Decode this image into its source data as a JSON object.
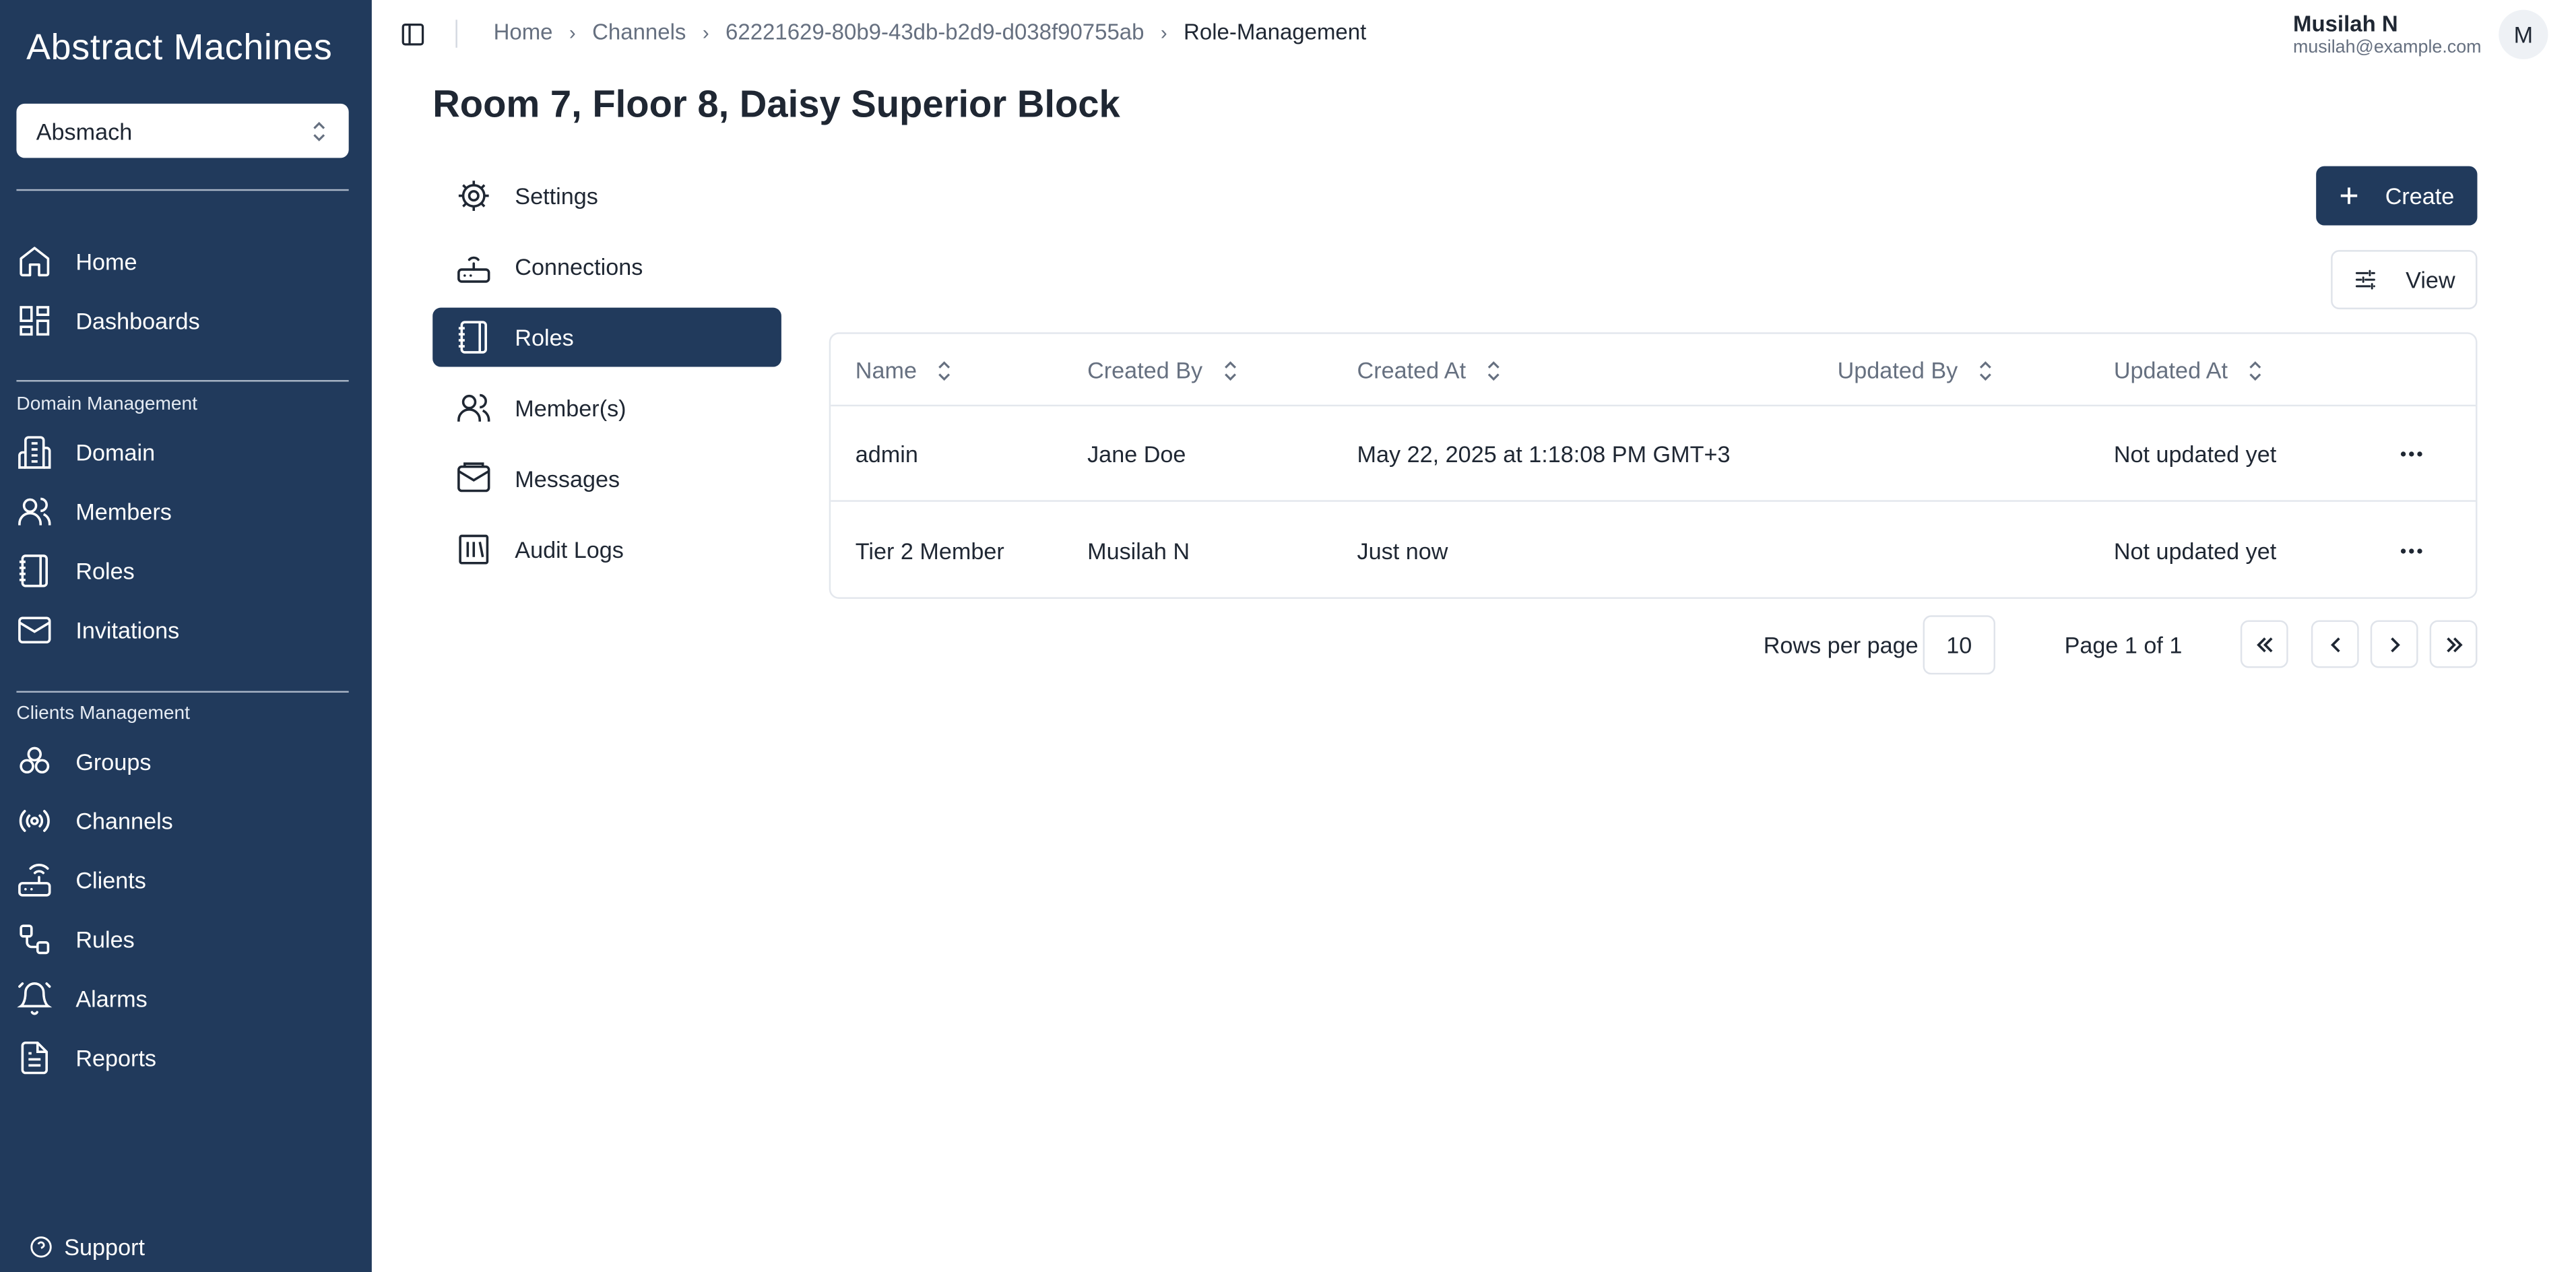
{
  "app": {
    "brand": "Abstract Machines"
  },
  "sidebar": {
    "domain_selector": "Absmach",
    "top_items": [
      {
        "label": "Home",
        "icon": "home-icon"
      },
      {
        "label": "Dashboards",
        "icon": "dashboard-icon"
      }
    ],
    "domain_section": {
      "title": "Domain Management",
      "items": [
        {
          "label": "Domain",
          "icon": "building-icon"
        },
        {
          "label": "Members",
          "icon": "users-icon"
        },
        {
          "label": "Roles",
          "icon": "notebook-icon"
        },
        {
          "label": "Invitations",
          "icon": "mail-icon"
        }
      ]
    },
    "clients_section": {
      "title": "Clients Management",
      "items": [
        {
          "label": "Groups",
          "icon": "groups-icon"
        },
        {
          "label": "Channels",
          "icon": "radio-icon"
        },
        {
          "label": "Clients",
          "icon": "router-icon"
        },
        {
          "label": "Rules",
          "icon": "workflow-icon"
        },
        {
          "label": "Alarms",
          "icon": "bell-icon"
        },
        {
          "label": "Reports",
          "icon": "file-icon"
        }
      ]
    },
    "support_label": "Support"
  },
  "breadcrumb": [
    "Home",
    "Channels",
    "62221629-80b9-43db-b2d9-d038f90755ab",
    "Role-Management"
  ],
  "user": {
    "name": "Musilah N",
    "email": "musilah@example.com",
    "initial": "M"
  },
  "page": {
    "title": "Room 7, Floor 8, Daisy Superior Block"
  },
  "channel_nav": [
    {
      "label": "Settings",
      "icon": "gear-icon"
    },
    {
      "label": "Connections",
      "icon": "router-icon"
    },
    {
      "label": "Roles",
      "icon": "notebook-icon",
      "active": true
    },
    {
      "label": "Member(s)",
      "icon": "users-icon"
    },
    {
      "label": "Messages",
      "icon": "mail-open-icon"
    },
    {
      "label": "Audit Logs",
      "icon": "logs-icon"
    }
  ],
  "toolbar": {
    "create_label": "Create",
    "view_label": "View"
  },
  "table": {
    "columns": [
      "Name",
      "Created By",
      "Created At",
      "Updated By",
      "Updated At"
    ],
    "rows": [
      [
        "admin",
        "Jane Doe",
        "May 22, 2025 at 1:18:08 PM GMT+3",
        "",
        "Not updated yet"
      ],
      [
        "Tier 2 Member",
        "Musilah N",
        "Just now",
        "",
        "Not updated yet"
      ]
    ]
  },
  "pagination": {
    "rows_per_page_label": "Rows per page",
    "rows_per_page": "10",
    "page_info": "Page 1 of 1"
  },
  "colors": {
    "sidebar": "#213a5c",
    "primary": "#213a5c",
    "border": "#e3e7ed",
    "muted_text": "#667080"
  }
}
